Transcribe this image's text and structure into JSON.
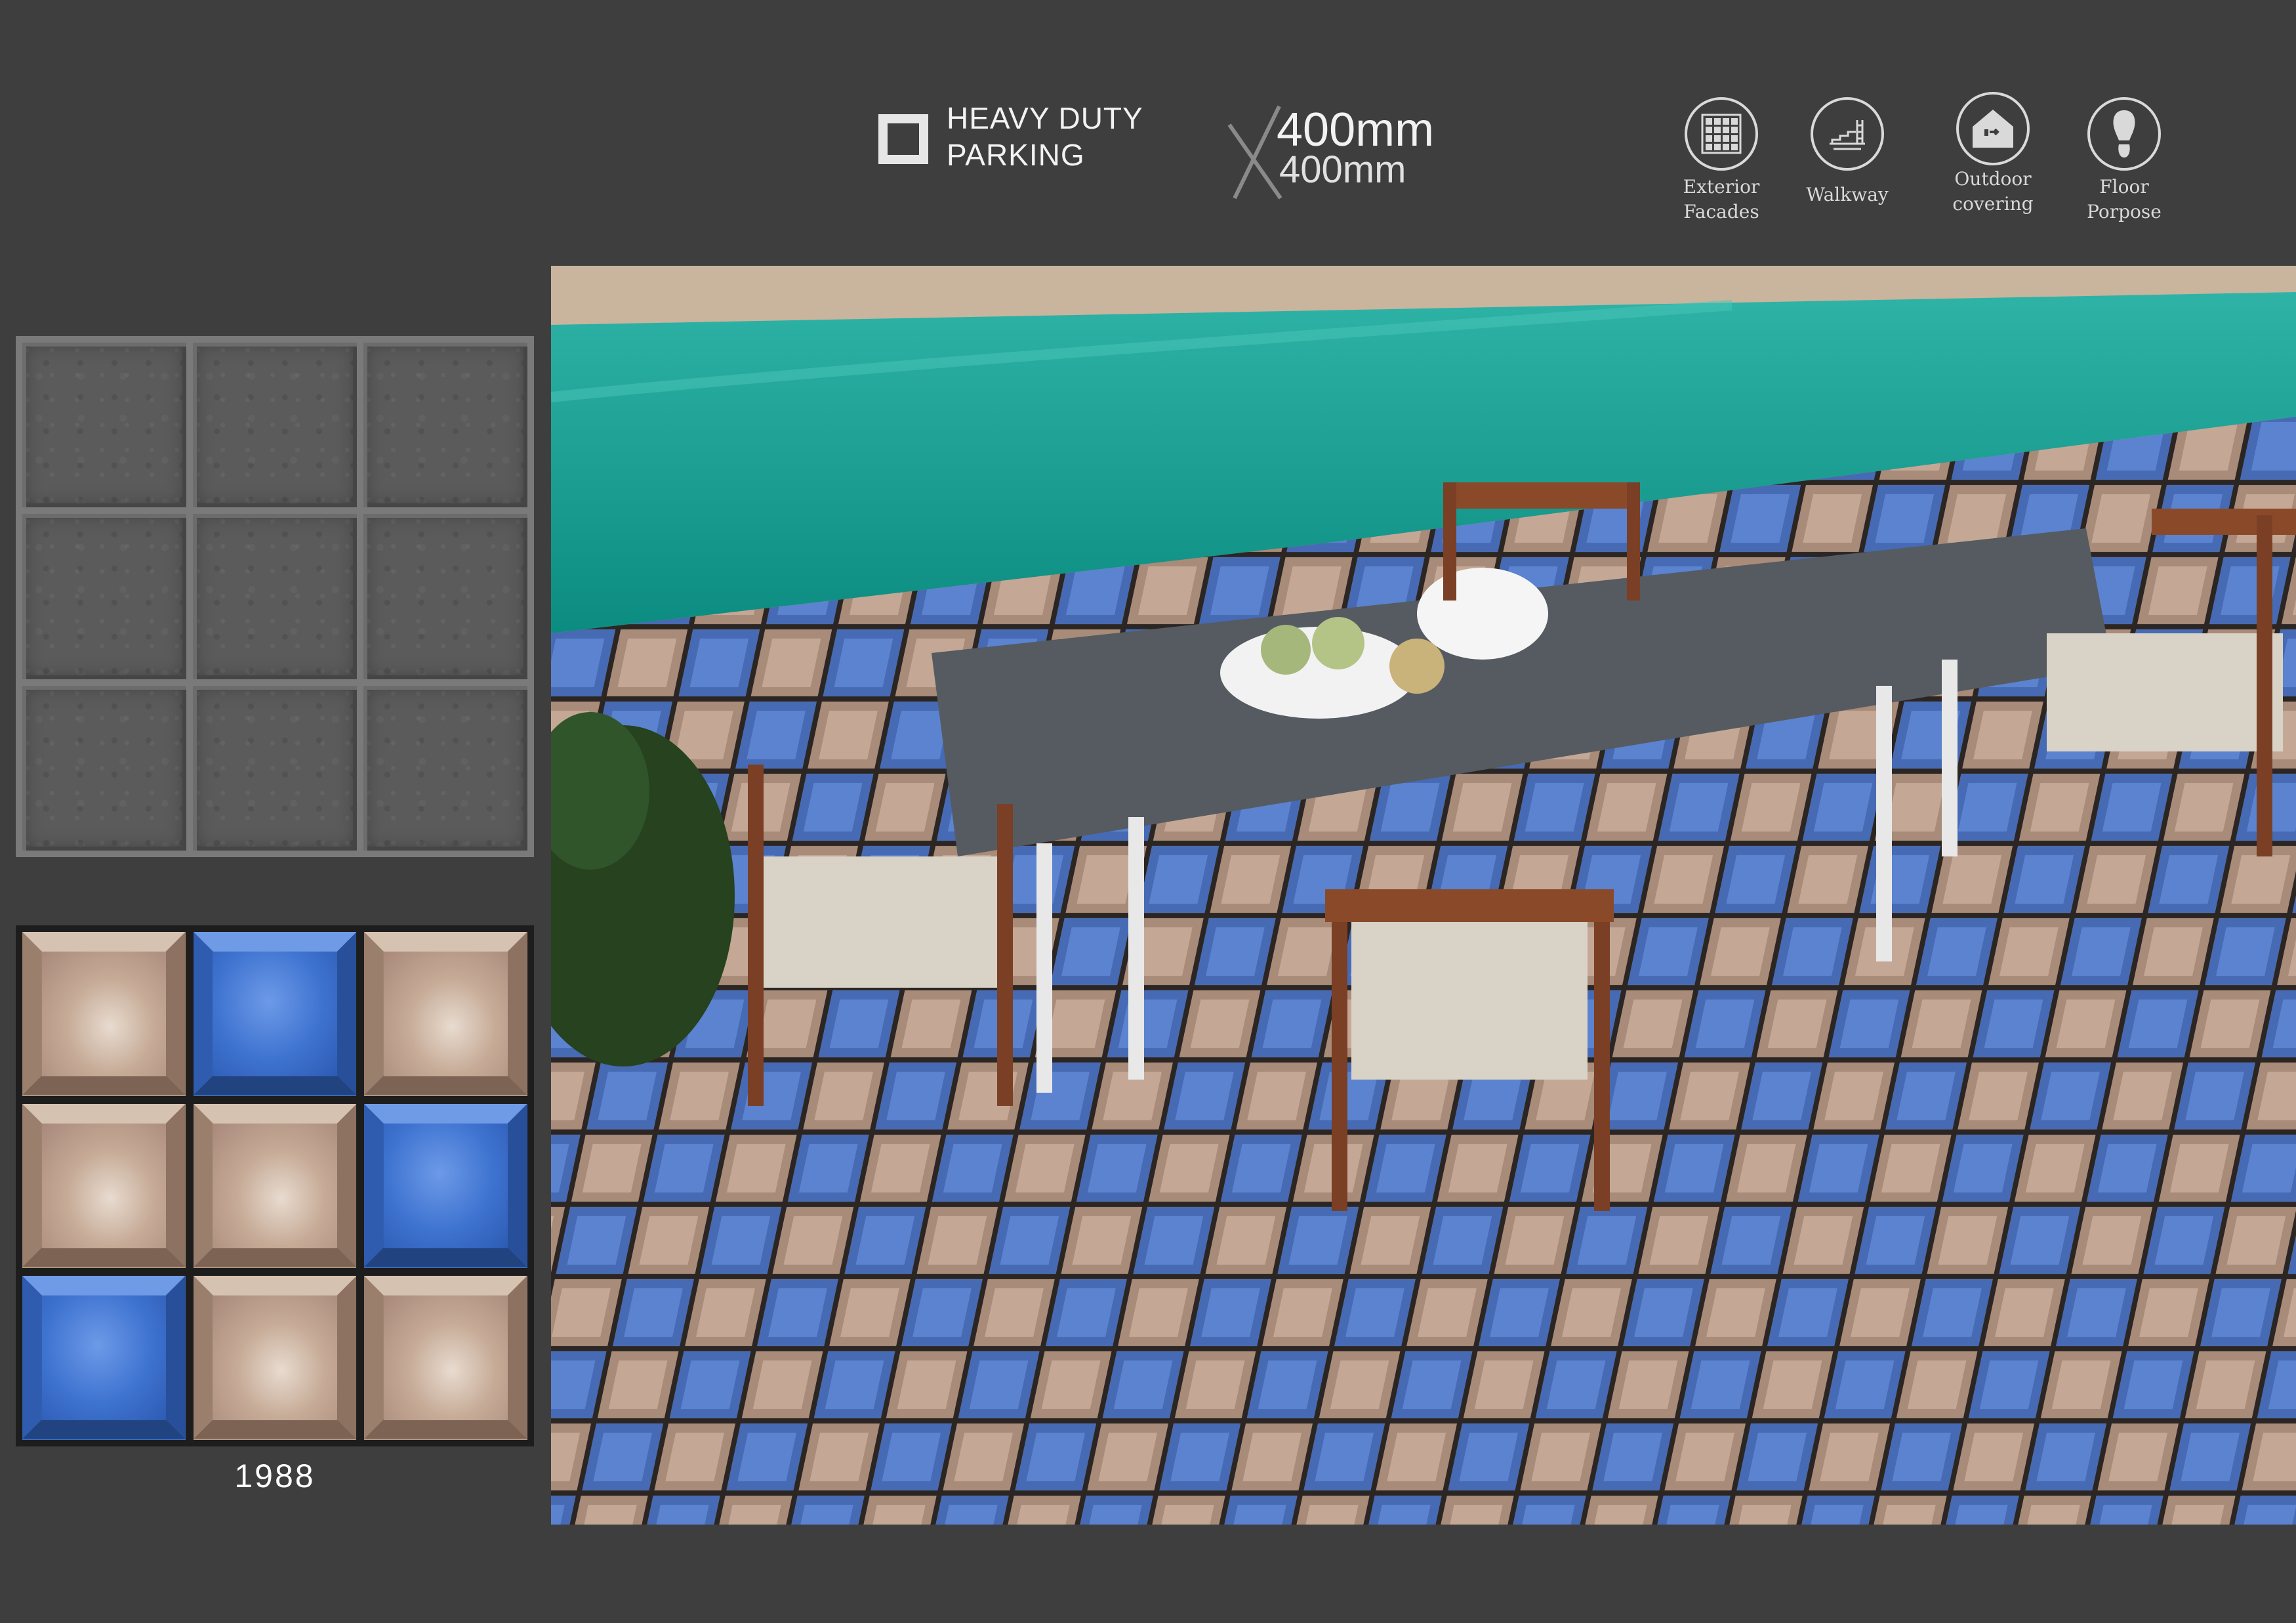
{
  "header": {
    "badge": {
      "line1": "HEAVY DUTY",
      "line2": "PARKING"
    },
    "size": {
      "width": "400mm",
      "height": "400mm"
    },
    "uses": [
      {
        "label_1": "Exterior",
        "label_2": "Facades",
        "icon": "grid-icon"
      },
      {
        "label_1": "Walkway",
        "label_2": "",
        "icon": "walkway-icon"
      },
      {
        "label_1": "Outdoor",
        "label_2": "covering",
        "icon": "house-icon"
      },
      {
        "label_1": "Floor",
        "label_2": "Porpose",
        "icon": "footprint-icon"
      }
    ]
  },
  "product": {
    "code": "1988"
  },
  "colors": {
    "background": "#3e3e3e",
    "tile_blue": "#3a6ec8",
    "tile_beige": "#b89c86",
    "pool": "#1aa59a"
  }
}
